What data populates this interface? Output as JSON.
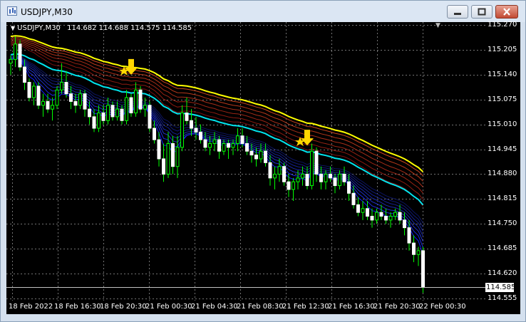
{
  "window": {
    "title": "USDJPY,M30",
    "colors": {
      "background": "#000000",
      "grid": "#c0c0c0",
      "bull_candle": "#ffffff",
      "bear_candle": "#00ff00",
      "upper_ma": "#ffff00",
      "lower_ma": "#00e5ee",
      "arrow": "#ffd700"
    }
  },
  "chart_header": {
    "symbol": "USDJPY,M30",
    "ohlc": "114.682 114.688 114.575 114.585"
  },
  "bid": "114.585",
  "chart_data": {
    "type": "candlestick",
    "symbol": "USDJPY",
    "timeframe": "M30",
    "ylim": [
      114.555,
      115.27
    ],
    "yticks": [
      "115.270",
      "115.205",
      "115.140",
      "115.075",
      "115.010",
      "114.945",
      "114.880",
      "114.815",
      "114.750",
      "114.685",
      "114.620",
      "114.555"
    ],
    "xticks": [
      "18 Feb 2022",
      "18 Feb 16:30",
      "18 Feb 20:30",
      "21 Feb 00:30",
      "21 Feb 04:30",
      "21 Feb 08:30",
      "21 Feb 12:30",
      "21 Feb 16:30",
      "21 Feb 20:30",
      "22 Feb 00:30"
    ],
    "last_ohlc": {
      "open": 114.682,
      "high": 114.688,
      "low": 114.575,
      "close": 114.585
    },
    "signals": [
      {
        "type": "sell-arrow",
        "price": 115.14
      },
      {
        "type": "sell-arrow",
        "price": 114.955
      }
    ],
    "candles": [
      [
        115.17,
        115.19,
        115.14,
        115.18
      ],
      [
        115.18,
        115.24,
        115.16,
        115.22
      ],
      [
        115.22,
        115.23,
        115.15,
        115.16
      ],
      [
        115.16,
        115.18,
        115.1,
        115.12
      ],
      [
        115.12,
        115.13,
        115.07,
        115.08
      ],
      [
        115.08,
        115.12,
        115.06,
        115.11
      ],
      [
        115.11,
        115.12,
        115.05,
        115.06
      ],
      [
        115.06,
        115.09,
        115.03,
        115.07
      ],
      [
        115.07,
        115.09,
        115.04,
        115.05
      ],
      [
        115.05,
        115.08,
        115.02,
        115.06
      ],
      [
        115.06,
        115.11,
        115.05,
        115.1
      ],
      [
        115.1,
        115.17,
        115.09,
        115.12
      ],
      [
        115.12,
        115.15,
        115.08,
        115.09
      ],
      [
        115.09,
        115.11,
        115.05,
        115.07
      ],
      [
        115.07,
        115.09,
        115.04,
        115.06
      ],
      [
        115.06,
        115.1,
        115.05,
        115.09
      ],
      [
        115.09,
        115.1,
        115.03,
        115.05
      ],
      [
        115.05,
        115.07,
        115.01,
        115.03
      ],
      [
        115.03,
        115.05,
        114.99,
        115.0
      ],
      [
        115.0,
        115.06,
        114.99,
        115.04
      ],
      [
        115.04,
        115.06,
        115.01,
        115.02
      ],
      [
        115.02,
        115.08,
        115.01,
        115.06
      ],
      [
        115.06,
        115.07,
        115.02,
        115.03
      ],
      [
        115.03,
        115.07,
        115.02,
        115.05
      ],
      [
        115.05,
        115.06,
        115.01,
        115.02
      ],
      [
        115.02,
        115.1,
        115.01,
        115.08
      ],
      [
        115.08,
        115.09,
        115.03,
        115.04
      ],
      [
        115.04,
        115.12,
        115.03,
        115.1
      ],
      [
        115.1,
        115.11,
        115.04,
        115.05
      ],
      [
        115.05,
        115.08,
        115.03,
        115.06
      ],
      [
        115.06,
        115.07,
        114.99,
        115.0
      ],
      [
        115.0,
        115.02,
        114.96,
        114.97
      ],
      [
        114.97,
        114.99,
        114.9,
        114.92
      ],
      [
        114.92,
        114.96,
        114.86,
        114.88
      ],
      [
        114.88,
        114.99,
        114.87,
        114.96
      ],
      [
        114.96,
        114.98,
        114.88,
        114.9
      ],
      [
        114.9,
        114.98,
        114.87,
        114.95
      ],
      [
        114.95,
        115.06,
        114.94,
        115.04
      ],
      [
        115.04,
        115.08,
        115.01,
        115.02
      ],
      [
        115.02,
        115.05,
        114.98,
        115.0
      ],
      [
        115.0,
        115.03,
        114.97,
        114.99
      ],
      [
        114.99,
        115.01,
        114.96,
        114.97
      ],
      [
        114.97,
        114.99,
        114.94,
        114.95
      ],
      [
        114.95,
        114.98,
        114.93,
        114.96
      ],
      [
        114.96,
        114.99,
        114.94,
        114.97
      ],
      [
        114.97,
        114.98,
        114.92,
        114.94
      ],
      [
        114.94,
        114.97,
        114.93,
        114.96
      ],
      [
        114.96,
        114.97,
        114.92,
        114.95
      ],
      [
        114.95,
        114.97,
        114.93,
        114.96
      ],
      [
        114.96,
        115.0,
        114.94,
        114.98
      ],
      [
        114.98,
        115.0,
        114.95,
        114.96
      ],
      [
        114.96,
        114.98,
        114.93,
        114.94
      ],
      [
        114.94,
        114.96,
        114.91,
        114.93
      ],
      [
        114.93,
        114.95,
        114.9,
        114.92
      ],
      [
        114.92,
        114.96,
        114.91,
        114.94
      ],
      [
        114.94,
        114.96,
        114.9,
        114.91
      ],
      [
        114.91,
        114.93,
        114.85,
        114.87
      ],
      [
        114.87,
        114.9,
        114.84,
        114.88
      ],
      [
        114.88,
        114.92,
        114.86,
        114.9
      ],
      [
        114.9,
        114.91,
        114.85,
        114.86
      ],
      [
        114.86,
        114.88,
        114.82,
        114.84
      ],
      [
        114.84,
        114.87,
        114.81,
        114.86
      ],
      [
        114.86,
        114.89,
        114.84,
        114.87
      ],
      [
        114.87,
        114.9,
        114.85,
        114.88
      ],
      [
        114.88,
        114.9,
        114.84,
        114.85
      ],
      [
        114.85,
        114.96,
        114.84,
        114.94
      ],
      [
        114.94,
        114.95,
        114.86,
        114.88
      ],
      [
        114.88,
        114.9,
        114.84,
        114.86
      ],
      [
        114.86,
        114.89,
        114.84,
        114.88
      ],
      [
        114.88,
        114.9,
        114.86,
        114.87
      ],
      [
        114.87,
        114.88,
        114.83,
        114.85
      ],
      [
        114.85,
        114.89,
        114.84,
        114.88
      ],
      [
        114.88,
        114.9,
        114.85,
        114.86
      ],
      [
        114.86,
        114.88,
        114.81,
        114.83
      ],
      [
        114.83,
        114.85,
        114.79,
        114.8
      ],
      [
        114.8,
        114.82,
        114.77,
        114.78
      ],
      [
        114.78,
        114.81,
        114.76,
        114.79
      ],
      [
        114.79,
        114.81,
        114.76,
        114.77
      ],
      [
        114.77,
        114.79,
        114.74,
        114.76
      ],
      [
        114.76,
        114.79,
        114.75,
        114.78
      ],
      [
        114.78,
        114.8,
        114.76,
        114.77
      ],
      [
        114.77,
        114.79,
        114.75,
        114.76
      ],
      [
        114.76,
        114.78,
        114.74,
        114.77
      ],
      [
        114.77,
        114.79,
        114.76,
        114.78
      ],
      [
        114.78,
        114.8,
        114.75,
        114.76
      ],
      [
        114.76,
        114.78,
        114.72,
        114.74
      ],
      [
        114.74,
        114.76,
        114.68,
        114.7
      ],
      [
        114.7,
        114.72,
        114.65,
        114.67
      ],
      [
        114.67,
        114.69,
        114.64,
        114.68
      ],
      [
        114.68,
        114.69,
        114.57,
        114.585
      ]
    ]
  }
}
